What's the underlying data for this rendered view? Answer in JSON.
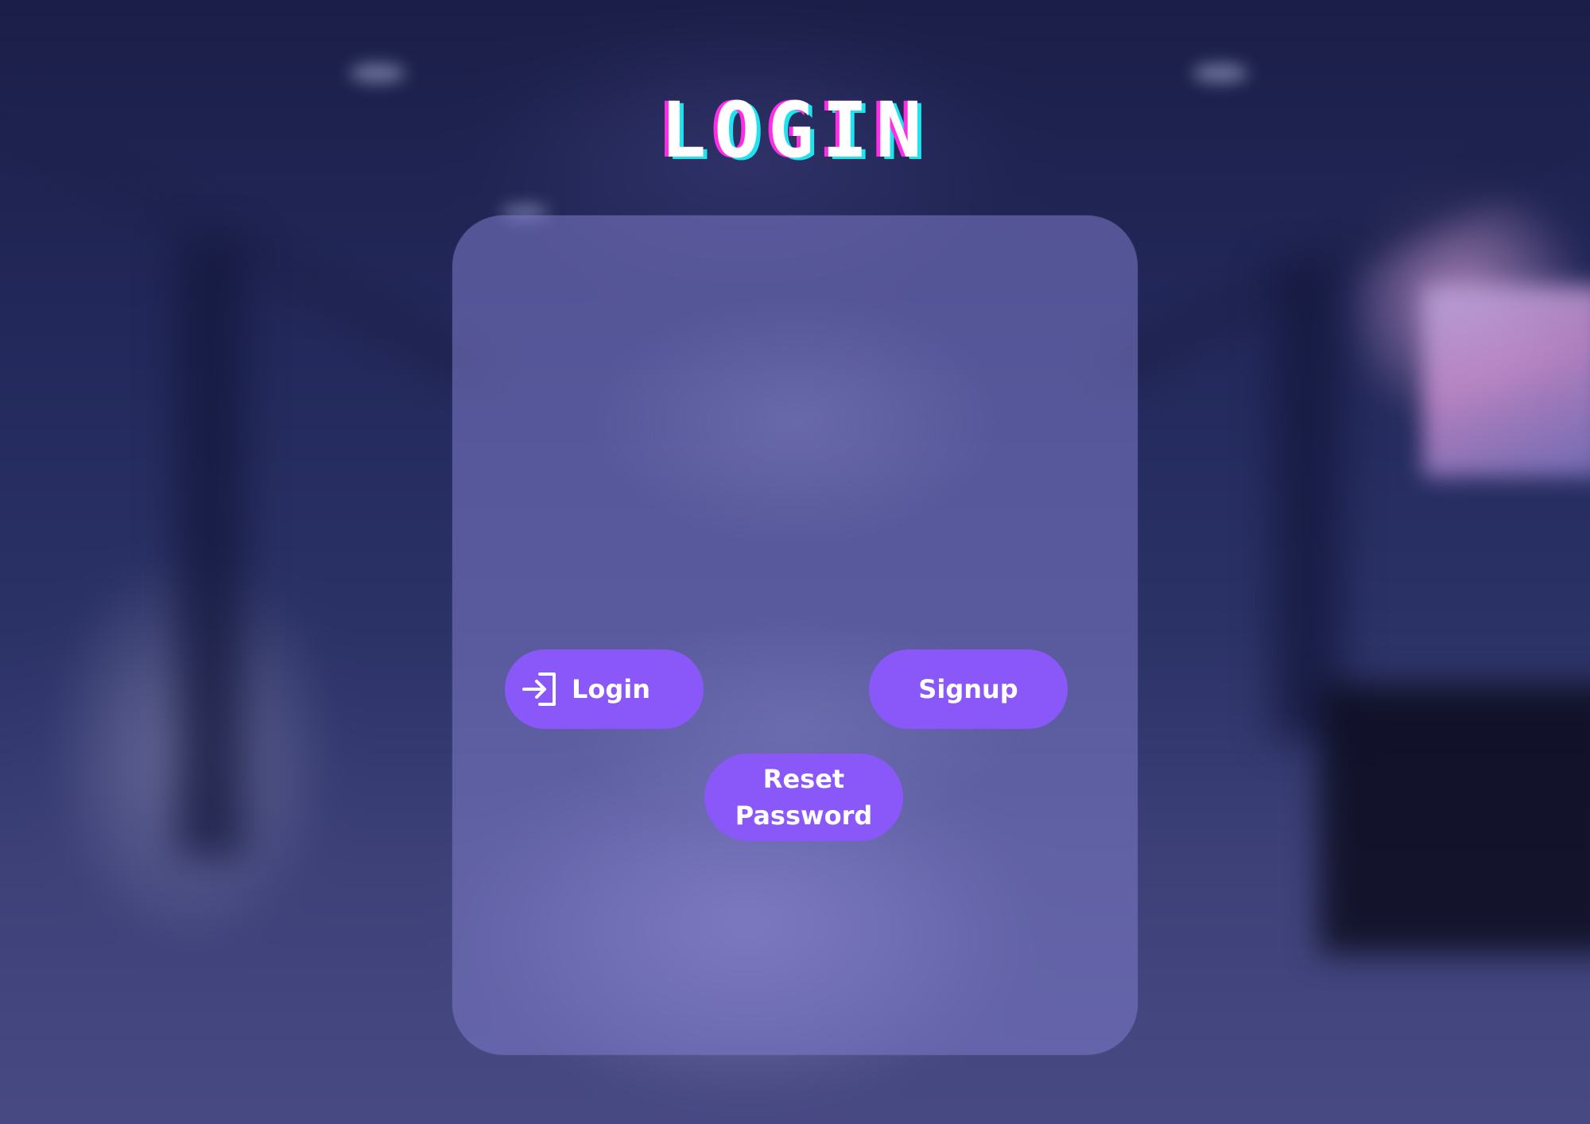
{
  "page": {
    "title": "LOGIN"
  },
  "buttons": {
    "login_label": "Login",
    "signup_label": "Signup",
    "reset_label": "Reset\nPassword"
  },
  "icons": {
    "login_icon": "login-icon"
  },
  "colors": {
    "button": "#8a57f8",
    "card": "#807ccc",
    "title": "#ffffff",
    "title_shadow_magenta": "#ff2ee6",
    "title_shadow_cyan": "#1fe4ee"
  }
}
